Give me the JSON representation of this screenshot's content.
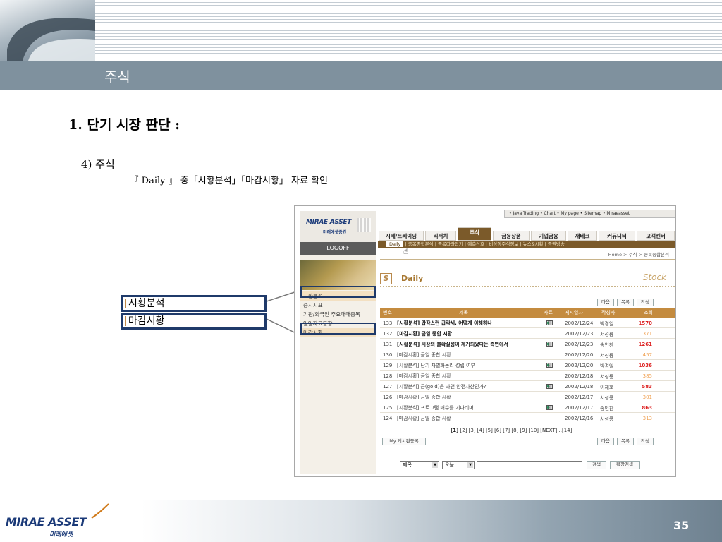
{
  "slide": {
    "title": "주식",
    "heading": "1. 단기 시장 판단 :",
    "subheading": "4) 주식",
    "instruction": "- 『 Daily 』 중「시황분석」「마감시황」 자료 확인",
    "page_number": "35",
    "footer_logo": {
      "brand": "MIRAE ASSET",
      "korean": "미래에셋"
    }
  },
  "callouts": [
    {
      "label": "시황분석"
    },
    {
      "label": "마감시황"
    }
  ],
  "browser": {
    "logo": {
      "brand": "MIRAE ASSET",
      "korean": "미래에셋증권"
    },
    "logoff": "LOGOFF",
    "top_links": "• Java Trading  • Chart  • My page  • Sitemap  • Miraeasset",
    "tabs": [
      "시세/트레이딩",
      "리서치",
      "주식",
      "금융상품",
      "기업금융",
      "재테크",
      "커뮤니티",
      "고객센터"
    ],
    "active_tab": "주식",
    "subnav": {
      "selected": "Daily",
      "rest": "| 종목종합분석 | 종목따라잡기 | 예측산호 | 비상장주식정보 | 뉴스&시황 | 증권방송"
    },
    "breadcrumb": "Home > 주식 > 종목종합분석",
    "left_menu": [
      "시황분석",
      "증시지표",
      "기관/외국인 주요매매종목",
      "일일자료동향",
      "마감시황"
    ],
    "section_title": "Daily",
    "section_icon": "S",
    "section_tag": "Stock",
    "buttons": {
      "next": "다음",
      "list": "목록",
      "write": "작성",
      "my_posts": "My 게시판등록"
    },
    "table": {
      "headers": [
        "번호",
        "제목",
        "자료",
        "게시일자",
        "작성자",
        "조회"
      ],
      "rows": [
        {
          "no": "133",
          "title": "[시황분석] 갑작스런 급락세, 어떻게 이해하나",
          "bold": true,
          "attach": true,
          "date": "2002/12/24",
          "author": "박경일",
          "views": "1570"
        },
        {
          "no": "132",
          "title": "[마감시황] 금일 종합 시황",
          "bold": true,
          "attach": false,
          "date": "2002/12/23",
          "author": "서성룡",
          "views": "371"
        },
        {
          "no": "131",
          "title": "[시황분석] 시장의 불확실성이 제거되었다는 측면에서",
          "bold": true,
          "attach": true,
          "date": "2002/12/23",
          "author": "송인찬",
          "views": "1261"
        },
        {
          "no": "130",
          "title": "[마감시황] 금일 종합 시황",
          "bold": false,
          "attach": false,
          "date": "2002/12/20",
          "author": "서성룡",
          "views": "457"
        },
        {
          "no": "129",
          "title": "[시황분석] 단기 차별화논리 성립 여부",
          "bold": false,
          "attach": true,
          "date": "2002/12/20",
          "author": "박경일",
          "views": "1036"
        },
        {
          "no": "128",
          "title": "[마감시황] 금일 종합 시황",
          "bold": false,
          "attach": false,
          "date": "2002/12/18",
          "author": "서성룡",
          "views": "385"
        },
        {
          "no": "127",
          "title": "[시황분석] 금(gold)은 과연 안전자산인가?",
          "bold": false,
          "attach": true,
          "date": "2002/12/18",
          "author": "이재호",
          "views": "583"
        },
        {
          "no": "126",
          "title": "[마감시황] 금일 종합 시황",
          "bold": false,
          "attach": false,
          "date": "2002/12/17",
          "author": "서성룡",
          "views": "301"
        },
        {
          "no": "125",
          "title": "[시황분석] 프로그램 매수를 기다리며",
          "bold": false,
          "attach": true,
          "date": "2002/12/17",
          "author": "송인찬",
          "views": "863"
        },
        {
          "no": "124",
          "title": "[마감시황] 금일 종합 시황",
          "bold": false,
          "attach": false,
          "date": "2002/12/16",
          "author": "서성룡",
          "views": "313"
        }
      ]
    },
    "pagination": {
      "current": "[1]",
      "pages": "[2] [3] [4] [5] [6] [7] [8] [9] [10]",
      "next": "[NEXT]...[14]"
    },
    "search": {
      "field": "제목",
      "period": "오늘",
      "query": "",
      "search_button": "검색",
      "advanced_button": "확장검색"
    }
  },
  "colors": {
    "header_bar": "#7f919e",
    "callout_border": "#1f3a6a",
    "brown_accent": "#7b5a2a",
    "table_header": "#c48b3f"
  }
}
